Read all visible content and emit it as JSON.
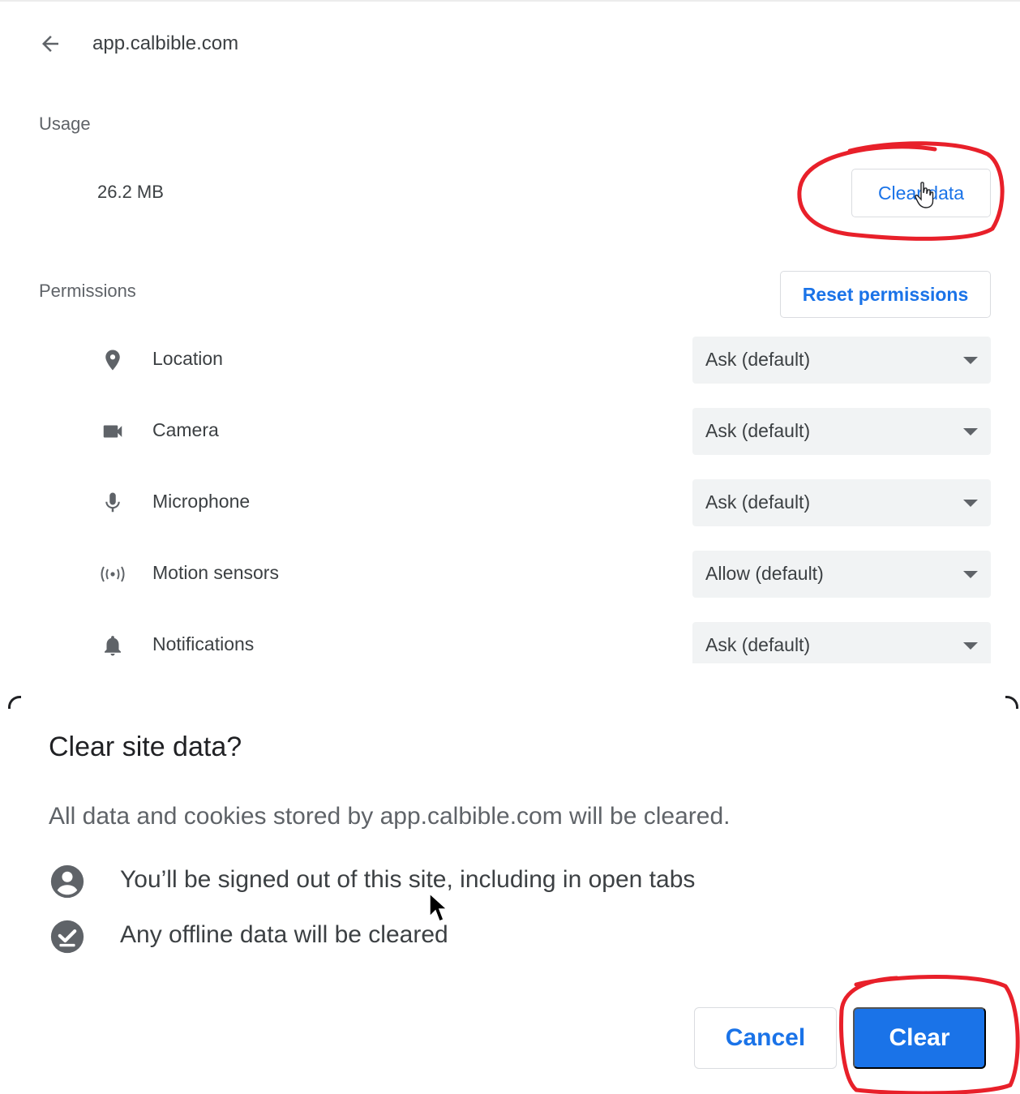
{
  "settings": {
    "site_title": "app.calbible.com",
    "usage": {
      "label": "Usage",
      "value": "26.2 MB",
      "clear_button_label": "Clear data"
    },
    "permissions": {
      "label": "Permissions",
      "reset_button_label": "Reset permissions",
      "items": [
        {
          "icon": "location-pin-icon",
          "label": "Location",
          "value": "Ask (default)"
        },
        {
          "icon": "camera-icon",
          "label": "Camera",
          "value": "Ask (default)"
        },
        {
          "icon": "microphone-icon",
          "label": "Microphone",
          "value": "Ask (default)"
        },
        {
          "icon": "motion-sensors-icon",
          "label": "Motion sensors",
          "value": "Allow (default)"
        },
        {
          "icon": "bell-icon",
          "label": "Notifications",
          "value": "Ask (default)"
        }
      ]
    }
  },
  "dialog": {
    "title": "Clear site data?",
    "description": "All data and cookies stored by app.calbible.com will be cleared.",
    "bullets": [
      {
        "icon": "account-circle-icon",
        "text": "You’ll be signed out of this site, including in open tabs"
      },
      {
        "icon": "offline-check-icon",
        "text": "Any offline data will be cleared"
      }
    ],
    "cancel_label": "Cancel",
    "confirm_label": "Clear"
  },
  "colors": {
    "accent": "#1a73e8",
    "annotation_red": "#e8202a",
    "select_background": "#f1f3f4"
  }
}
